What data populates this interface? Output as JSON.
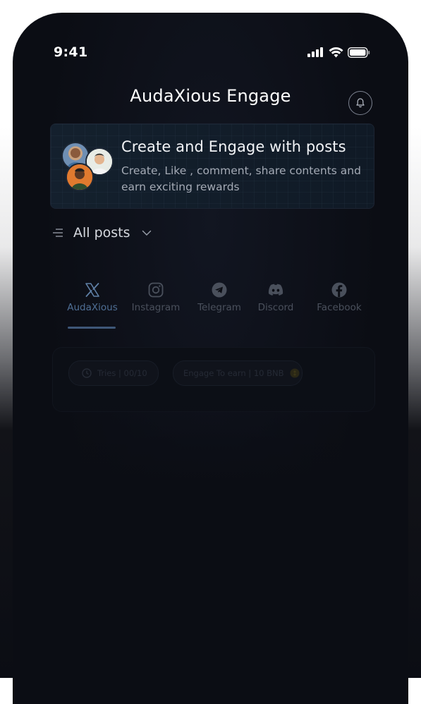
{
  "status_bar": {
    "time": "9:41"
  },
  "header": {
    "title": "AudaXious Engage"
  },
  "banner": {
    "title": "Create and Engage with posts",
    "subtitle": "Create, Like , comment, share contents and earn exciting rewards"
  },
  "filter": {
    "label": "All posts"
  },
  "tabs": [
    {
      "label": "AudaXious",
      "icon": "x-logo-icon",
      "active": true
    },
    {
      "label": "Instagram",
      "icon": "instagram-icon",
      "active": false
    },
    {
      "label": "Telegram",
      "icon": "telegram-icon",
      "active": false
    },
    {
      "label": "Discord",
      "icon": "discord-icon",
      "active": false
    },
    {
      "label": "Facebook",
      "icon": "facebook-icon",
      "active": false
    }
  ],
  "post_card": {
    "chip_left": "Tries | 00/10",
    "chip_right": "Engage To earn | 10 BNB"
  },
  "colors": {
    "background": "#0b0d14",
    "active_tab": "#4f6f95",
    "inactive_tab": "#4a505c",
    "text_primary": "#ffffff"
  }
}
